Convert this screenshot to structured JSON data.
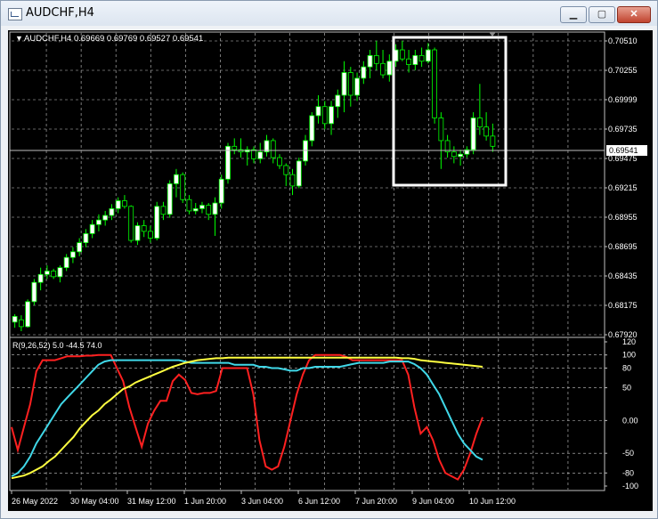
{
  "window": {
    "title": "AUDCHF,H4",
    "min_glyph": "▁",
    "max_glyph": "▢",
    "close_glyph": "✕"
  },
  "chart_header": {
    "text": "AUDCHF,H4  0.69669 0.69769 0.69527 0.69541",
    "arrow": "▼"
  },
  "price_axis": {
    "labels": [
      "0.70510",
      "0.70255",
      "0.69999",
      "0.69735",
      "0.69475",
      "0.69215",
      "0.68955",
      "0.68695",
      "0.68435",
      "0.68175",
      "0.67920"
    ],
    "current_price": "0.69541"
  },
  "indicator": {
    "label": "R(9,26,52) 5.0 -44.5 74.0",
    "labels": [
      "120",
      "100",
      "80",
      "50",
      "0.00",
      "-50",
      "-80",
      "-100"
    ]
  },
  "time_axis": [
    "26 May 2022",
    "30 May 04:00",
    "31 May 12:00",
    "1 Jun 20:00",
    "3 Jun 04:00",
    "6 Jun 12:00",
    "7 Jun 20:00",
    "9 Jun 04:00",
    "10 Jun 12:00"
  ],
  "colors": {
    "bull": "#ffffff",
    "bear": "#000000",
    "candle_outline": "#00ff00",
    "red_line": "#ff2020",
    "cyan_line": "#40d8e8",
    "yellow_line": "#ffff40",
    "grid": "#c8c8c8",
    "highlight": "#ffffff"
  },
  "chart_data": {
    "type": "candlestick",
    "symbol": "AUDCHF",
    "timeframe": "H4",
    "ylim": [
      0.6792,
      0.7051
    ],
    "candles": [
      [
        0.68,
        0.6807,
        0.6795,
        0.6805
      ],
      [
        0.6802,
        0.6806,
        0.6792,
        0.6796
      ],
      [
        0.6796,
        0.682,
        0.6795,
        0.6818
      ],
      [
        0.6818,
        0.6838,
        0.6815,
        0.6835
      ],
      [
        0.6835,
        0.6848,
        0.6828,
        0.6842
      ],
      [
        0.6842,
        0.685,
        0.6838,
        0.6845
      ],
      [
        0.6845,
        0.6847,
        0.6838,
        0.684
      ],
      [
        0.684,
        0.685,
        0.6835,
        0.6848
      ],
      [
        0.6848,
        0.686,
        0.6845,
        0.6857
      ],
      [
        0.6857,
        0.6866,
        0.6852,
        0.6862
      ],
      [
        0.6862,
        0.6874,
        0.6858,
        0.687
      ],
      [
        0.687,
        0.6882,
        0.6866,
        0.6878
      ],
      [
        0.6878,
        0.689,
        0.6874,
        0.6886
      ],
      [
        0.6886,
        0.6895,
        0.688,
        0.689
      ],
      [
        0.689,
        0.6898,
        0.6885,
        0.6894
      ],
      [
        0.6894,
        0.6904,
        0.689,
        0.69
      ],
      [
        0.69,
        0.691,
        0.6896,
        0.6907
      ],
      [
        0.6907,
        0.6912,
        0.69,
        0.6902
      ],
      [
        0.6902,
        0.6903,
        0.687,
        0.6872
      ],
      [
        0.6872,
        0.6888,
        0.6868,
        0.6885
      ],
      [
        0.6885,
        0.689,
        0.6875,
        0.688
      ],
      [
        0.688,
        0.6885,
        0.687,
        0.6874
      ],
      [
        0.6874,
        0.6906,
        0.6872,
        0.6902
      ],
      [
        0.6902,
        0.6906,
        0.689,
        0.6895
      ],
      [
        0.6895,
        0.6925,
        0.6892,
        0.6922
      ],
      [
        0.6922,
        0.6935,
        0.691,
        0.693
      ],
      [
        0.693,
        0.6932,
        0.6905,
        0.6908
      ],
      [
        0.6908,
        0.6912,
        0.6895,
        0.6898
      ],
      [
        0.6898,
        0.6905,
        0.6895,
        0.69
      ],
      [
        0.69,
        0.6906,
        0.6896,
        0.6903
      ],
      [
        0.6903,
        0.6905,
        0.689,
        0.6895
      ],
      [
        0.6895,
        0.691,
        0.6876,
        0.6905
      ],
      [
        0.6905,
        0.693,
        0.69,
        0.6926
      ],
      [
        0.6926,
        0.6958,
        0.6922,
        0.6955
      ],
      [
        0.6955,
        0.6962,
        0.6948,
        0.6952
      ],
      [
        0.6952,
        0.6962,
        0.6945,
        0.695
      ],
      [
        0.695,
        0.6955,
        0.6938,
        0.6952
      ],
      [
        0.6952,
        0.6955,
        0.694,
        0.6944
      ],
      [
        0.6944,
        0.6958,
        0.694,
        0.695
      ],
      [
        0.695,
        0.6965,
        0.6946,
        0.696
      ],
      [
        0.696,
        0.6962,
        0.694,
        0.6945
      ],
      [
        0.6945,
        0.6948,
        0.6935,
        0.6938
      ],
      [
        0.6938,
        0.694,
        0.692,
        0.693
      ],
      [
        0.693,
        0.6935,
        0.6912,
        0.692
      ],
      [
        0.692,
        0.6945,
        0.6918,
        0.6942
      ],
      [
        0.6942,
        0.6965,
        0.6938,
        0.696
      ],
      [
        0.696,
        0.6985,
        0.6955,
        0.6982
      ],
      [
        0.6982,
        0.7,
        0.6975,
        0.699
      ],
      [
        0.699,
        0.6995,
        0.697,
        0.6975
      ],
      [
        0.6975,
        0.6995,
        0.6965,
        0.699
      ],
      [
        0.699,
        0.7005,
        0.698,
        0.7
      ],
      [
        0.7,
        0.703,
        0.6985,
        0.702
      ],
      [
        0.702,
        0.7025,
        0.699,
        0.7
      ],
      [
        0.7,
        0.702,
        0.6995,
        0.7015
      ],
      [
        0.7015,
        0.703,
        0.701,
        0.7025
      ],
      [
        0.7025,
        0.704,
        0.7015,
        0.7035
      ],
      [
        0.7035,
        0.7048,
        0.7022,
        0.7028
      ],
      [
        0.7028,
        0.704,
        0.7015,
        0.7018
      ],
      [
        0.7018,
        0.7036,
        0.7012,
        0.703
      ],
      [
        0.703,
        0.7045,
        0.7025,
        0.704
      ],
      [
        0.704,
        0.7048,
        0.703,
        0.7032
      ],
      [
        0.7032,
        0.704,
        0.702,
        0.7027
      ],
      [
        0.7027,
        0.704,
        0.7022,
        0.7035
      ],
      [
        0.7035,
        0.7042,
        0.7025,
        0.703
      ],
      [
        0.703,
        0.7046,
        0.7028,
        0.704
      ],
      [
        0.704,
        0.7042,
        0.6975,
        0.698
      ],
      [
        0.698,
        0.6985,
        0.6935,
        0.696
      ],
      [
        0.696,
        0.6965,
        0.6945,
        0.695
      ],
      [
        0.695,
        0.6955,
        0.694,
        0.6946
      ],
      [
        0.6946,
        0.6952,
        0.6938,
        0.6948
      ],
      [
        0.6948,
        0.6955,
        0.6945,
        0.6952
      ],
      [
        0.6952,
        0.6985,
        0.6948,
        0.698
      ],
      [
        0.698,
        0.701,
        0.6965,
        0.6972
      ],
      [
        0.6972,
        0.6985,
        0.696,
        0.6964
      ],
      [
        0.6964,
        0.6975,
        0.695,
        0.6955
      ]
    ],
    "indicator_ylim": [
      -100,
      120
    ],
    "red_line": [
      -10,
      -45,
      -10,
      25,
      75,
      92,
      92,
      92,
      95,
      98,
      98,
      98,
      99,
      99,
      100,
      100,
      100,
      80,
      60,
      20,
      -10,
      -40,
      -5,
      15,
      30,
      30,
      60,
      70,
      62,
      42,
      40,
      42,
      42,
      45,
      80,
      80,
      80,
      80,
      80,
      40,
      -30,
      -70,
      -75,
      -70,
      -40,
      0,
      40,
      70,
      92,
      100,
      100,
      100,
      100,
      100,
      97,
      92,
      92,
      92,
      92,
      92,
      92,
      92,
      92,
      92,
      70,
      20,
      -20,
      -10,
      -30,
      -60,
      -80,
      -85,
      -90,
      -75,
      -50,
      -20,
      5
    ],
    "cyan_line": [
      -85,
      -80,
      -70,
      -55,
      -35,
      -20,
      -5,
      10,
      25,
      35,
      45,
      55,
      65,
      75,
      85,
      90,
      92,
      92,
      92,
      92,
      92,
      92,
      92,
      92,
      92,
      92,
      92,
      92,
      90,
      88,
      88,
      88,
      88,
      88,
      88,
      88,
      85,
      85,
      85,
      85,
      82,
      82,
      80,
      80,
      78,
      76,
      76,
      80,
      80,
      82,
      82,
      82,
      82,
      82,
      84,
      86,
      88,
      88,
      88,
      88,
      88,
      90,
      90,
      90,
      90,
      86,
      80,
      70,
      55,
      40,
      20,
      0,
      -20,
      -35,
      -45,
      -55,
      -60
    ],
    "yellow_line": [
      -88,
      -86,
      -84,
      -80,
      -75,
      -70,
      -62,
      -55,
      -45,
      -35,
      -25,
      -12,
      -2,
      8,
      15,
      25,
      32,
      40,
      48,
      52,
      58,
      62,
      66,
      70,
      74,
      78,
      82,
      85,
      88,
      90,
      92,
      93,
      94,
      95,
      95,
      96,
      96,
      96,
      96,
      96,
      96,
      96,
      96,
      96,
      96,
      96,
      96,
      96,
      96,
      96,
      96,
      96,
      96,
      96,
      96,
      96,
      96,
      96,
      96,
      96,
      96,
      96,
      96,
      95,
      95,
      94,
      92,
      91,
      90,
      89,
      88,
      87,
      86,
      85,
      84,
      83,
      82
    ]
  }
}
